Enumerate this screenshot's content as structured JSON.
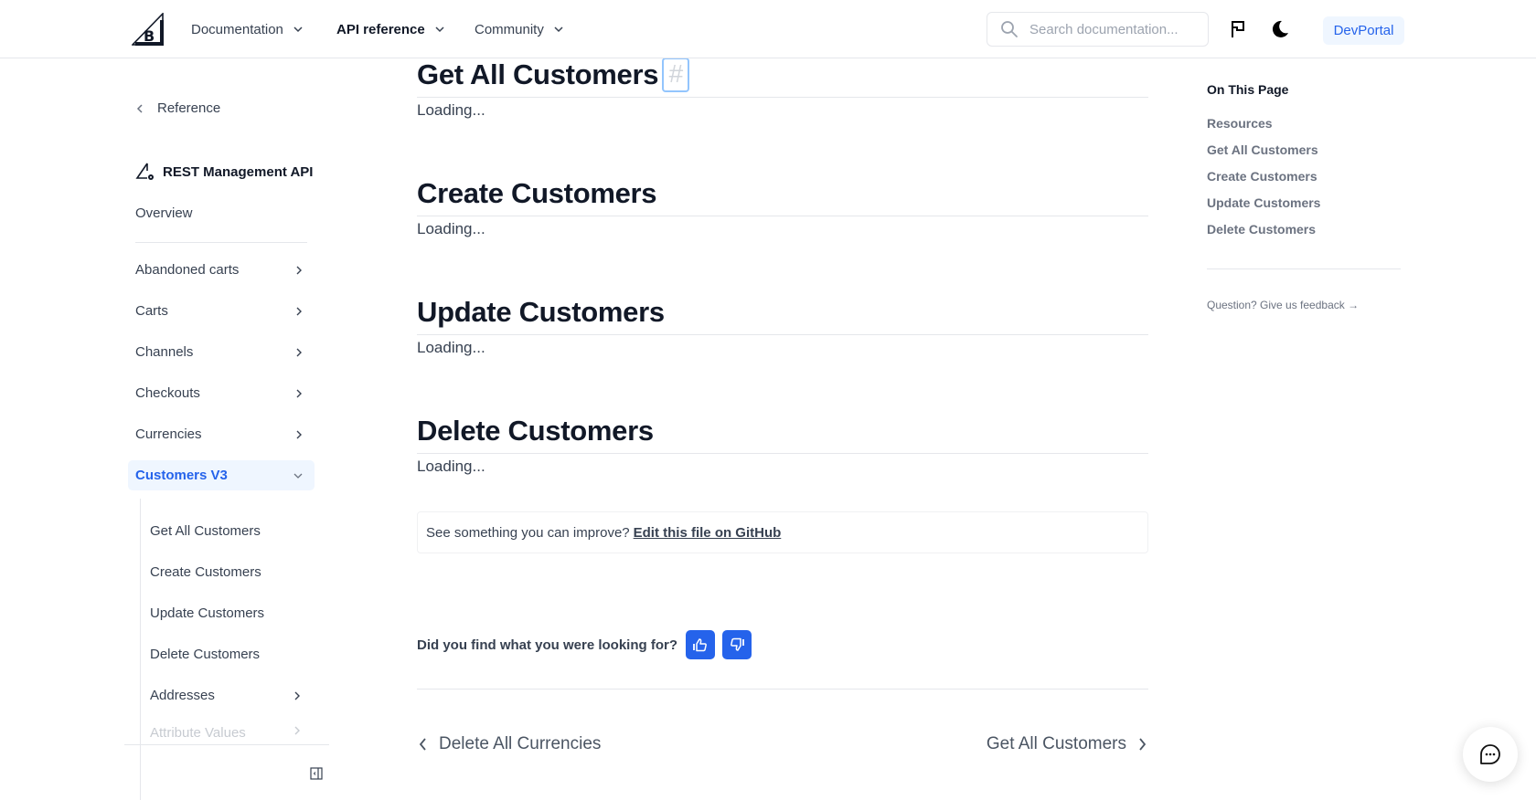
{
  "header": {
    "logo": "bigcommerce-logo",
    "nav": [
      {
        "label": "Documentation",
        "active": false
      },
      {
        "label": "API reference",
        "active": true
      },
      {
        "label": "Community",
        "active": false
      }
    ],
    "search_placeholder": "Search documentation...",
    "devportal_label": "DevPortal",
    "icons": [
      "search-icon",
      "flag-icon",
      "moon-icon"
    ]
  },
  "sidebar": {
    "back_label": "Reference",
    "api_title": "REST Management API",
    "overview_label": "Overview",
    "items": [
      {
        "label": "Abandoned carts"
      },
      {
        "label": "Carts"
      },
      {
        "label": "Channels"
      },
      {
        "label": "Checkouts"
      },
      {
        "label": "Currencies"
      },
      {
        "label": "Customers V3",
        "active": true,
        "expanded": true
      }
    ],
    "sub_items": [
      {
        "label": "Get All Customers"
      },
      {
        "label": "Create Customers"
      },
      {
        "label": "Update Customers"
      },
      {
        "label": "Delete Customers"
      },
      {
        "label": "Addresses",
        "has_children": true
      },
      {
        "label": "Attribute Values",
        "has_children": true
      }
    ]
  },
  "main": {
    "sections": [
      {
        "title": "Get All Customers",
        "anchor": "#",
        "body": "Loading..."
      },
      {
        "title": "Create Customers",
        "body": "Loading..."
      },
      {
        "title": "Update Customers",
        "body": "Loading..."
      },
      {
        "title": "Delete Customers",
        "body": "Loading..."
      }
    ],
    "github_prompt": "See something you can improve?",
    "github_link": "Edit this file on GitHub",
    "feedback_question": "Did you find what you were looking for?",
    "prev_label": "Delete All Currencies",
    "next_label": "Get All Customers"
  },
  "toc": {
    "title": "On This Page",
    "links": [
      "Resources",
      "Get All Customers",
      "Create Customers",
      "Update Customers",
      "Delete Customers"
    ],
    "feedback_label": "Question? Give us feedback →"
  },
  "colors": {
    "accent": "#2563eb",
    "accent_bg": "#eff6ff",
    "text": "#374151",
    "heading": "#111827",
    "muted": "#6b7280",
    "border": "#e5e7eb"
  }
}
